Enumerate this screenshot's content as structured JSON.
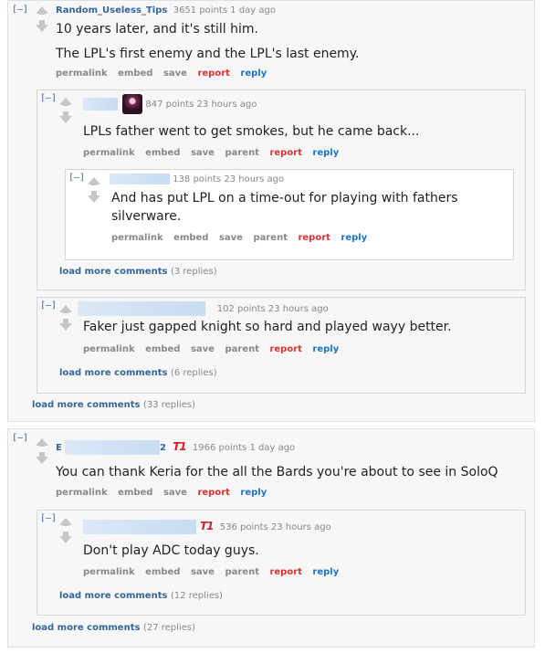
{
  "comments": [
    {
      "author": "Random_Useless_Tips",
      "points": "3651 points",
      "time": "1 day ago",
      "body": "10 years later, and it's still him.",
      "body2": "The LPL's first enemy and the LPL's last enemy.",
      "replies": [
        {
          "points": "847 points",
          "time": "23 hours ago",
          "body": "LPLs father went to get smokes, but he came back...",
          "replies": [
            {
              "points": "138 points",
              "time": "23 hours ago",
              "body": "And has put LPL on a time-out for playing with fathers",
              "body2": "silverware."
            }
          ],
          "more_label": "load more comments",
          "more_count": "(3 replies)"
        },
        {
          "points": "102 points",
          "time": "23 hours ago",
          "body": "Faker just gapped knight so hard and played wayy better.",
          "more_label": "load more comments",
          "more_count": "(6 replies)"
        }
      ],
      "more_label": "load more comments",
      "more_count": "(33 replies)"
    },
    {
      "author_initial": "E",
      "author_tail": "2",
      "points": "1966 points",
      "time": "1 day ago",
      "body": "You can thank Keria for the all the Bards you're about to see in SoloQ",
      "replies": [
        {
          "points": "536 points",
          "time": "23 hours ago",
          "body": "Don't play ADC today guys.",
          "more_label": "load more comments",
          "more_count": "(12 replies)"
        }
      ],
      "more_label": "load more comments",
      "more_count": "(27 replies)"
    }
  ],
  "ui": {
    "toggle": "[–]",
    "permalink": "permalink",
    "embed": "embed",
    "save": "save",
    "parent": "parent",
    "report": "report",
    "reply": "reply",
    "team_flair": "T1",
    "colors": {
      "link": "#336699",
      "report": "#dd3333",
      "reply": "#1d74c5",
      "meta": "#888888"
    }
  }
}
